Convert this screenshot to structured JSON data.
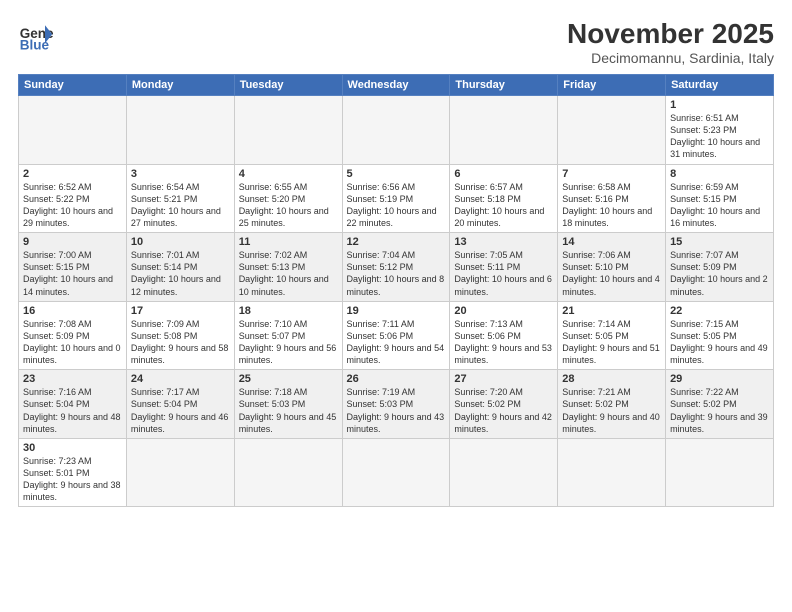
{
  "header": {
    "logo_general": "General",
    "logo_blue": "Blue",
    "month": "November 2025",
    "location": "Decimomannu, Sardinia, Italy"
  },
  "weekdays": [
    "Sunday",
    "Monday",
    "Tuesday",
    "Wednesday",
    "Thursday",
    "Friday",
    "Saturday"
  ],
  "weeks": [
    [
      {
        "day": "",
        "info": ""
      },
      {
        "day": "",
        "info": ""
      },
      {
        "day": "",
        "info": ""
      },
      {
        "day": "",
        "info": ""
      },
      {
        "day": "",
        "info": ""
      },
      {
        "day": "",
        "info": ""
      },
      {
        "day": "1",
        "info": "Sunrise: 6:51 AM\nSunset: 5:23 PM\nDaylight: 10 hours\nand 31 minutes."
      }
    ],
    [
      {
        "day": "2",
        "info": "Sunrise: 6:52 AM\nSunset: 5:22 PM\nDaylight: 10 hours\nand 29 minutes."
      },
      {
        "day": "3",
        "info": "Sunrise: 6:54 AM\nSunset: 5:21 PM\nDaylight: 10 hours\nand 27 minutes."
      },
      {
        "day": "4",
        "info": "Sunrise: 6:55 AM\nSunset: 5:20 PM\nDaylight: 10 hours\nand 25 minutes."
      },
      {
        "day": "5",
        "info": "Sunrise: 6:56 AM\nSunset: 5:19 PM\nDaylight: 10 hours\nand 22 minutes."
      },
      {
        "day": "6",
        "info": "Sunrise: 6:57 AM\nSunset: 5:18 PM\nDaylight: 10 hours\nand 20 minutes."
      },
      {
        "day": "7",
        "info": "Sunrise: 6:58 AM\nSunset: 5:16 PM\nDaylight: 10 hours\nand 18 minutes."
      },
      {
        "day": "8",
        "info": "Sunrise: 6:59 AM\nSunset: 5:15 PM\nDaylight: 10 hours\nand 16 minutes."
      }
    ],
    [
      {
        "day": "9",
        "info": "Sunrise: 7:00 AM\nSunset: 5:15 PM\nDaylight: 10 hours\nand 14 minutes."
      },
      {
        "day": "10",
        "info": "Sunrise: 7:01 AM\nSunset: 5:14 PM\nDaylight: 10 hours\nand 12 minutes."
      },
      {
        "day": "11",
        "info": "Sunrise: 7:02 AM\nSunset: 5:13 PM\nDaylight: 10 hours\nand 10 minutes."
      },
      {
        "day": "12",
        "info": "Sunrise: 7:04 AM\nSunset: 5:12 PM\nDaylight: 10 hours\nand 8 minutes."
      },
      {
        "day": "13",
        "info": "Sunrise: 7:05 AM\nSunset: 5:11 PM\nDaylight: 10 hours\nand 6 minutes."
      },
      {
        "day": "14",
        "info": "Sunrise: 7:06 AM\nSunset: 5:10 PM\nDaylight: 10 hours\nand 4 minutes."
      },
      {
        "day": "15",
        "info": "Sunrise: 7:07 AM\nSunset: 5:09 PM\nDaylight: 10 hours\nand 2 minutes."
      }
    ],
    [
      {
        "day": "16",
        "info": "Sunrise: 7:08 AM\nSunset: 5:09 PM\nDaylight: 10 hours\nand 0 minutes."
      },
      {
        "day": "17",
        "info": "Sunrise: 7:09 AM\nSunset: 5:08 PM\nDaylight: 9 hours\nand 58 minutes."
      },
      {
        "day": "18",
        "info": "Sunrise: 7:10 AM\nSunset: 5:07 PM\nDaylight: 9 hours\nand 56 minutes."
      },
      {
        "day": "19",
        "info": "Sunrise: 7:11 AM\nSunset: 5:06 PM\nDaylight: 9 hours\nand 54 minutes."
      },
      {
        "day": "20",
        "info": "Sunrise: 7:13 AM\nSunset: 5:06 PM\nDaylight: 9 hours\nand 53 minutes."
      },
      {
        "day": "21",
        "info": "Sunrise: 7:14 AM\nSunset: 5:05 PM\nDaylight: 9 hours\nand 51 minutes."
      },
      {
        "day": "22",
        "info": "Sunrise: 7:15 AM\nSunset: 5:05 PM\nDaylight: 9 hours\nand 49 minutes."
      }
    ],
    [
      {
        "day": "23",
        "info": "Sunrise: 7:16 AM\nSunset: 5:04 PM\nDaylight: 9 hours\nand 48 minutes."
      },
      {
        "day": "24",
        "info": "Sunrise: 7:17 AM\nSunset: 5:04 PM\nDaylight: 9 hours\nand 46 minutes."
      },
      {
        "day": "25",
        "info": "Sunrise: 7:18 AM\nSunset: 5:03 PM\nDaylight: 9 hours\nand 45 minutes."
      },
      {
        "day": "26",
        "info": "Sunrise: 7:19 AM\nSunset: 5:03 PM\nDaylight: 9 hours\nand 43 minutes."
      },
      {
        "day": "27",
        "info": "Sunrise: 7:20 AM\nSunset: 5:02 PM\nDaylight: 9 hours\nand 42 minutes."
      },
      {
        "day": "28",
        "info": "Sunrise: 7:21 AM\nSunset: 5:02 PM\nDaylight: 9 hours\nand 40 minutes."
      },
      {
        "day": "29",
        "info": "Sunrise: 7:22 AM\nSunset: 5:02 PM\nDaylight: 9 hours\nand 39 minutes."
      }
    ],
    [
      {
        "day": "30",
        "info": "Sunrise: 7:23 AM\nSunset: 5:01 PM\nDaylight: 9 hours\nand 38 minutes."
      },
      {
        "day": "",
        "info": ""
      },
      {
        "day": "",
        "info": ""
      },
      {
        "day": "",
        "info": ""
      },
      {
        "day": "",
        "info": ""
      },
      {
        "day": "",
        "info": ""
      },
      {
        "day": "",
        "info": ""
      }
    ]
  ]
}
